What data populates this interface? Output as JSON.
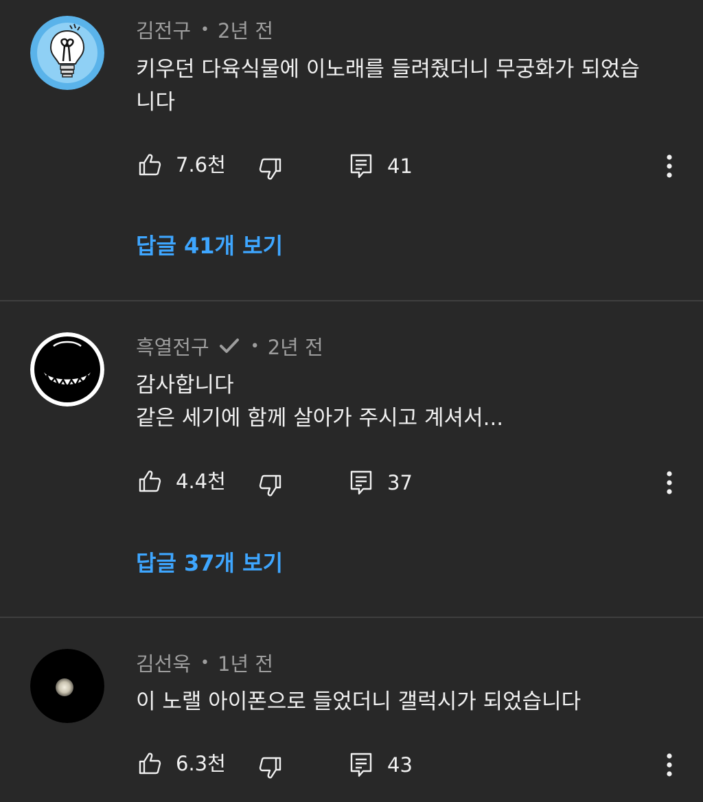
{
  "colors": {
    "background": "#282828",
    "text_primary": "#f1f1f1",
    "text_secondary": "#9e9e9e",
    "link_blue": "#3ea6ff",
    "divider": "#3f3f3f"
  },
  "comments": [
    {
      "author": "김전구",
      "verified": false,
      "separator": "•",
      "time": "2년 전",
      "avatar_icon": "lightbulb-avatar-icon",
      "text_lines": [
        "키우던 다육식물에 이노래를 들려줬더니 무궁화가 되었습",
        "니다"
      ],
      "likes": "7.6천",
      "reply_count": "41",
      "replies_label": "답글 41개 보기"
    },
    {
      "author": "흑열전구",
      "verified": true,
      "separator": "•",
      "time": "2년 전",
      "avatar_icon": "grin-face-avatar-icon",
      "text_lines": [
        "감사합니다",
        "같은 세기에 함께 살아가 주시고 계셔서..."
      ],
      "likes": "4.4천",
      "reply_count": "37",
      "replies_label": "답글 37개 보기"
    },
    {
      "author": "김선욱",
      "verified": false,
      "separator": "•",
      "time": "1년 전",
      "avatar_icon": "moon-avatar-icon",
      "text_lines": [
        "이 노랠 아이폰으로 들었더니 갤럭시가 되었습니다"
      ],
      "likes": "6.3천",
      "reply_count": "43"
    }
  ]
}
